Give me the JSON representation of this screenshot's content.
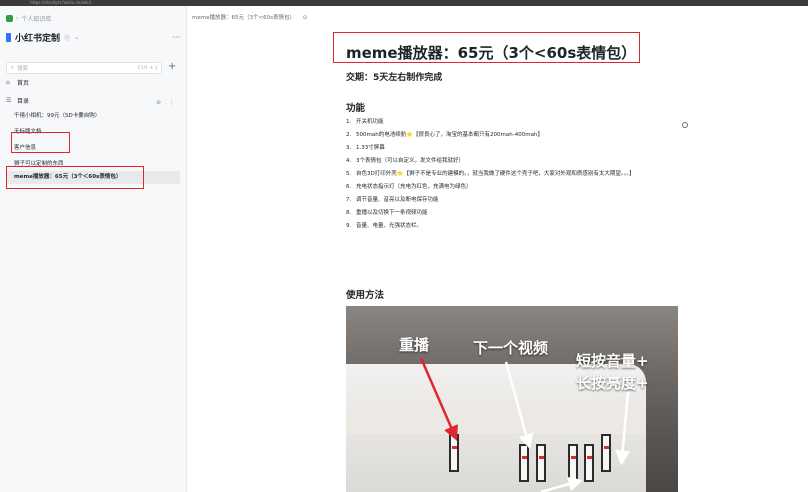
{
  "browser": {
    "url": "https://xhsdiyzt.feishu.cn/wiki/..."
  },
  "sidebar": {
    "breadcrumb": "个人知识库",
    "space_title": "小红书定制",
    "space_icon": "ⓢ",
    "search": {
      "placeholder": "搜索",
      "shortcut": "Ctrl + J"
    },
    "nav": [
      {
        "icon": "⌂",
        "label": "首页"
      },
      {
        "icon": "☰",
        "label": "目录"
      }
    ],
    "dir_tools": "⊕ ⋮",
    "docs": [
      {
        "label": "千禧小相机：99元（SD卡要自购）",
        "active": false
      },
      {
        "label": "无标题文档",
        "active": false
      },
      {
        "label": "客户信息",
        "active": false
      },
      {
        "label": "狮子可以定制的东西",
        "active": false
      },
      {
        "label": "meme播放器：65元（3个＜60s表情包）",
        "active": true
      }
    ]
  },
  "page": {
    "header_path": "meme播放器：65元（3个<60s表情包）",
    "header_icon": "⊙",
    "title": "meme播放器：65元（3个<60s表情包）",
    "delivery": "交期：5天左右制作完成",
    "features_heading": "功能",
    "features": [
      {
        "n": "1.",
        "text": "开关机功能"
      },
      {
        "n": "2.",
        "text": "500mah的电池续航⭐【很良心了，淘宝的基本都只有200mah-400mah】"
      },
      {
        "n": "3.",
        "text": "1.33寸屏幕"
      },
      {
        "n": "4.",
        "text": "3个表情包（可以自定义，发文件给我就好）"
      },
      {
        "n": "5.",
        "text": "自色3D打印外壳⭐【狮子不是专业的建模的。，就当我做了硬件这个壳子吧，大家对外观和质感别有太大期望。。。】"
      },
      {
        "n": "6.",
        "text": "充电状态指示灯（充电为红色，充满电为绿色）"
      },
      {
        "n": "7.",
        "text": "调节音量、音亮以及断电保存功能"
      },
      {
        "n": "8.",
        "text": "重播以及切换下一条视频功能"
      },
      {
        "n": "9.",
        "text": "音量、电量、光强状态栏。"
      }
    ],
    "usage_heading": "使用方法",
    "photo_labels": {
      "replay": "重播",
      "next": "下一个视频",
      "short_press": "短按音量+",
      "long_press": "长按亮度+"
    }
  }
}
